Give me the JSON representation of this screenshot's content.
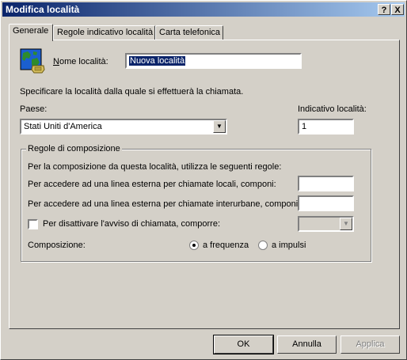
{
  "window": {
    "title": "Modifica località"
  },
  "title_buttons": {
    "help": "?",
    "close": "X"
  },
  "tabs": [
    {
      "label": "Generale",
      "active": true
    },
    {
      "label": "Regole indicativo località",
      "active": false
    },
    {
      "label": "Carta telefonica",
      "active": false
    }
  ],
  "general": {
    "location_icon": "globe-phone-icon",
    "location_name_label": "Nome località:",
    "location_name_value": "Nuova località",
    "specify_text": "Specificare la località dalla quale si effettuerà la chiamata.",
    "country_label": "Paese:",
    "country_value": "Stati Uniti d'America",
    "area_code_label": "Indicativo località:",
    "area_code_value": "1",
    "dialing_rules": {
      "title": "Regole di composizione",
      "intro": "Per la  composizione da questa località, utilizza le seguenti regole:",
      "local_label": "Per accedere ad una linea esterna per chiamate locali, componi:",
      "local_value": "",
      "long_distance_label": "Per accedere ad una linea esterna per chiamate interurbane, componi:",
      "long_distance_value": "",
      "call_waiting_label": "Per disattivare l'avviso di chiamata, comporre:",
      "call_waiting_checked": false,
      "call_waiting_value": "",
      "dialing_label": "Composizione:",
      "tone_label": "a frequenza",
      "pulse_label": "a impulsi",
      "selected": "tone"
    }
  },
  "buttons": {
    "ok": "OK",
    "cancel": "Annulla",
    "apply": "Applica"
  },
  "colors": {
    "face": "#d4d0c8",
    "title_start": "#0a246a",
    "title_end": "#a6caf0",
    "selection": "#0a246a"
  }
}
